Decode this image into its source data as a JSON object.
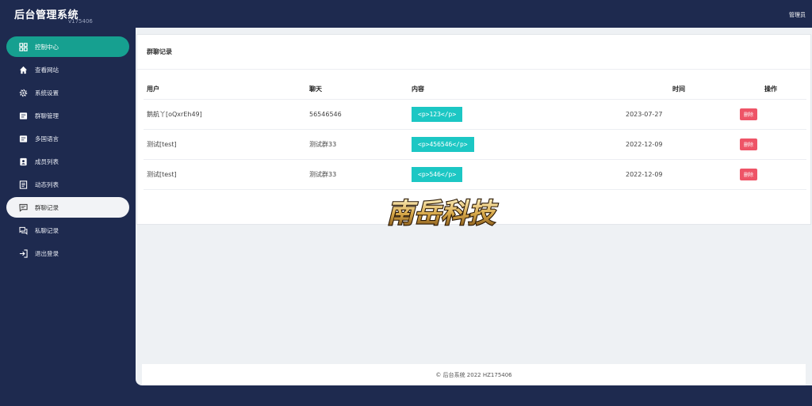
{
  "header": {
    "title": "后台管理系统",
    "version": "v175406",
    "admin": "管理员"
  },
  "sidebar": {
    "items": [
      {
        "label": "控制中心",
        "icon": "dashboard-icon"
      },
      {
        "label": "查看网站",
        "icon": "home-icon"
      },
      {
        "label": "系统设置",
        "icon": "gear-icon"
      },
      {
        "label": "群聊管理",
        "icon": "list-icon"
      },
      {
        "label": "多国语言",
        "icon": "list-icon"
      },
      {
        "label": "成员列表",
        "icon": "contacts-icon"
      },
      {
        "label": "动态列表",
        "icon": "document-icon"
      },
      {
        "label": "群聊记录",
        "icon": "chat-icon"
      },
      {
        "label": "私聊记录",
        "icon": "chats-icon"
      },
      {
        "label": "退出登录",
        "icon": "logout-icon"
      }
    ]
  },
  "main": {
    "title": "群聊记录",
    "columns": {
      "user": "用户",
      "chat": "聊天",
      "content": "内容",
      "time": "时间",
      "action": "操作"
    },
    "rows": [
      {
        "user": "鹅航丫[oQxrEh49]",
        "chat": "56546546",
        "content": "<p>123</p>",
        "time": "2023-07-27",
        "action": "删除"
      },
      {
        "user": "测试[test]",
        "chat": "测试群33",
        "content": "<p>456546</p>",
        "time": "2022-12-09",
        "action": "删除"
      },
      {
        "user": "测试[test]",
        "chat": "测试群33",
        "content": "<p>546</p>",
        "time": "2022-12-09",
        "action": "删除"
      }
    ]
  },
  "watermark": {
    "text": "南岳科技"
  },
  "footer": {
    "text": "© 后台系统 2022 HZ175406"
  },
  "colors": {
    "sidebar_bg": "#1e2a4f",
    "active_teal": "#16a090",
    "tag": "#1cc7c4",
    "delete": "#ee5467"
  }
}
